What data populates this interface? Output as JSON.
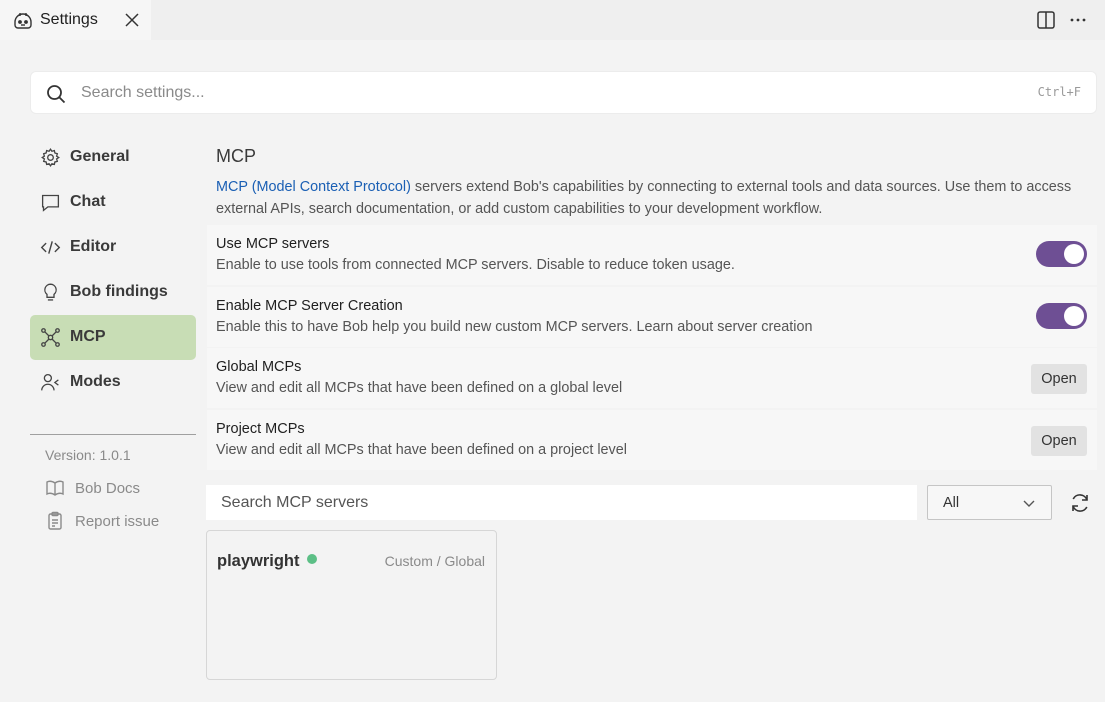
{
  "tab": {
    "title": "Settings"
  },
  "search": {
    "placeholder": "Search settings...",
    "shortcut": "Ctrl+F"
  },
  "sidebar": {
    "items": [
      {
        "label": "General",
        "icon": "gear-icon"
      },
      {
        "label": "Chat",
        "icon": "chat-bubble-icon"
      },
      {
        "label": "Editor",
        "icon": "code-icon"
      },
      {
        "label": "Bob findings",
        "icon": "lightbulb-icon"
      },
      {
        "label": "MCP",
        "icon": "network-icon",
        "active": true
      },
      {
        "label": "Modes",
        "icon": "user-mode-icon"
      }
    ],
    "version": "Version: 1.0.1",
    "links": [
      {
        "label": "Bob Docs",
        "icon": "book-icon"
      },
      {
        "label": "Report issue",
        "icon": "clipboard-icon"
      }
    ]
  },
  "main": {
    "title": "MCP",
    "description_link": "MCP (Model Context Protocol)",
    "description_rest": " servers extend Bob's capabilities by connecting to external tools and data sources. Use them to access external APIs, search documentation, or add custom capabilities to your development workflow.",
    "settings": [
      {
        "title": "Use MCP servers",
        "desc": "Enable to use tools from connected MCP servers. Disable to reduce token usage.",
        "control": "toggle",
        "enabled": true
      },
      {
        "title": "Enable MCP Server Creation",
        "desc": "Enable this to have Bob help you build new custom MCP servers. Learn about server creation",
        "control": "toggle",
        "enabled": true
      },
      {
        "title": "Global MCPs",
        "desc": "View and edit all MCPs that have been defined on a global level",
        "control": "button",
        "button_label": "Open"
      },
      {
        "title": "Project MCPs",
        "desc": "View and edit all MCPs that have been defined on a project level",
        "control": "button",
        "button_label": "Open"
      }
    ],
    "mcp_search": {
      "placeholder": "Search MCP servers"
    },
    "filter": {
      "selected": "All"
    },
    "servers": [
      {
        "name": "playwright",
        "status": "connected",
        "status_color": "#5cbf86",
        "scope": "Custom / Global"
      }
    ]
  },
  "colors": {
    "accent": "#6e4f94",
    "active_nav": "#c8ddb5",
    "link": "#1a5fb4"
  }
}
